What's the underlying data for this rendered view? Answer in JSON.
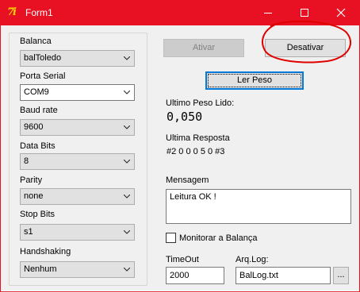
{
  "window": {
    "title": "Form1",
    "app_icon_text": "7i",
    "accent_color": "#e81123"
  },
  "titlebar": {
    "minimize": "minimize",
    "maximize": "maximize",
    "close": "close"
  },
  "settings": {
    "balanca": {
      "label": "Balanca",
      "value": "balToledo"
    },
    "porta_serial": {
      "label": "Porta Serial",
      "value": "COM9"
    },
    "baud_rate": {
      "label": "Baud rate",
      "value": "9600"
    },
    "data_bits": {
      "label": "Data Bits",
      "value": "8"
    },
    "parity": {
      "label": "Parity",
      "value": "none"
    },
    "stop_bits": {
      "label": "Stop Bits",
      "value": "s1"
    },
    "handshaking": {
      "label": "Handshaking",
      "value": "Nenhum"
    }
  },
  "actions": {
    "ativar": "Ativar",
    "desativar": "Desativar",
    "ler_peso": "Ler Peso"
  },
  "status": {
    "ultimo_peso_label": "Ultimo Peso Lido:",
    "ultimo_peso_value": "0,050",
    "ultima_resposta_label": "Ultima Resposta",
    "ultima_resposta_value": "#2 0 0 0 5 0 #3",
    "mensagem_label": "Mensagem",
    "mensagem_value": "Leitura OK !"
  },
  "monitor": {
    "label": "Monitorar a Balança",
    "checked": false
  },
  "timeout": {
    "label": "TimeOut",
    "value": "2000"
  },
  "arqlog": {
    "label": "Arq.Log:",
    "value": "BalLog.txt",
    "browse": "..."
  }
}
